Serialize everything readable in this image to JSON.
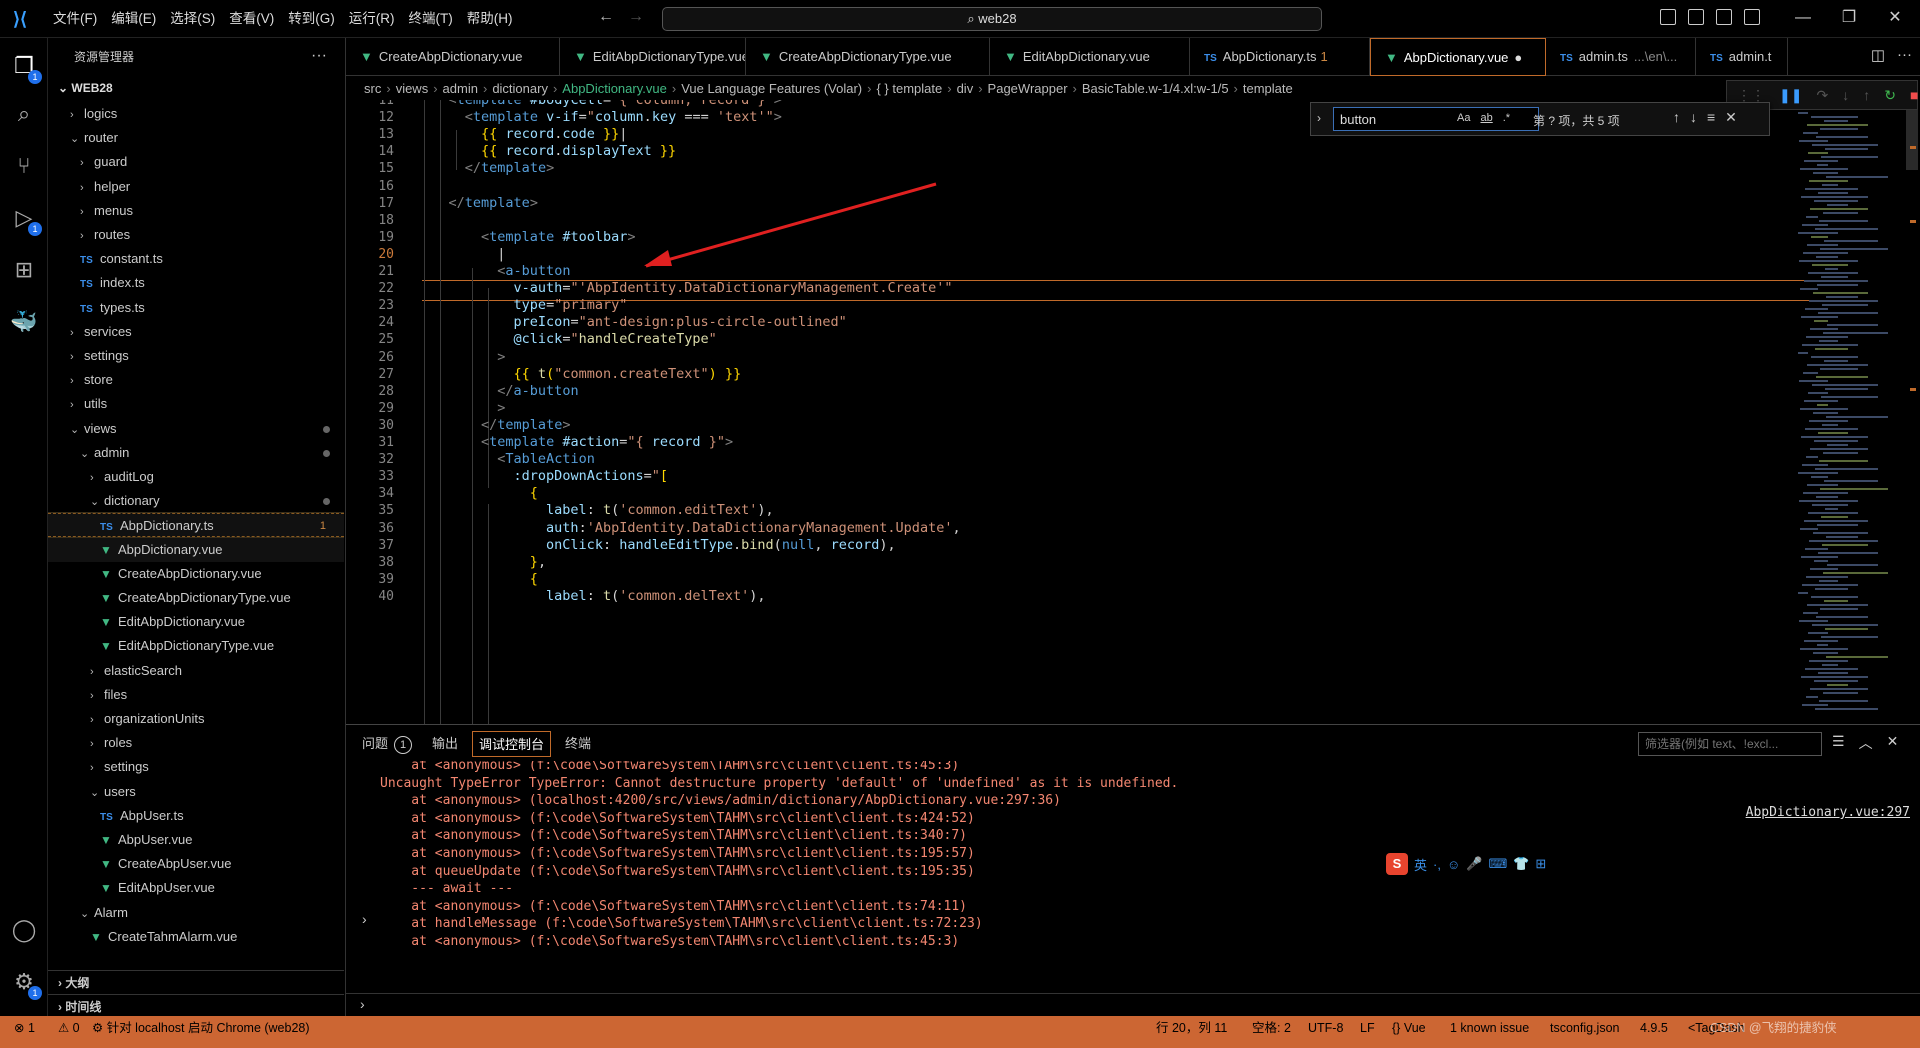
{
  "menubar": [
    "文件(F)",
    "编辑(E)",
    "选择(S)",
    "查看(V)",
    "转到(G)",
    "运行(R)",
    "终端(T)",
    "帮助(H)"
  ],
  "command_center": "web28",
  "sidebar": {
    "title": "资源管理器",
    "more": "···",
    "workspace": "WEB28",
    "tree": [
      {
        "label": "logics",
        "kind": "folder",
        "open": false,
        "depth": 1
      },
      {
        "label": "router",
        "kind": "folder",
        "open": true,
        "depth": 1
      },
      {
        "label": "guard",
        "kind": "folder",
        "open": false,
        "depth": 2
      },
      {
        "label": "helper",
        "kind": "folder",
        "open": false,
        "depth": 2
      },
      {
        "label": "menus",
        "kind": "folder",
        "open": false,
        "depth": 2
      },
      {
        "label": "routes",
        "kind": "folder",
        "open": false,
        "depth": 2
      },
      {
        "label": "constant.ts",
        "kind": "ts",
        "depth": 2
      },
      {
        "label": "index.ts",
        "kind": "ts",
        "depth": 2
      },
      {
        "label": "types.ts",
        "kind": "ts",
        "depth": 2
      },
      {
        "label": "services",
        "kind": "folder",
        "open": false,
        "depth": 1
      },
      {
        "label": "settings",
        "kind": "folder",
        "open": false,
        "depth": 1
      },
      {
        "label": "store",
        "kind": "folder",
        "open": false,
        "depth": 1
      },
      {
        "label": "utils",
        "kind": "folder",
        "open": false,
        "depth": 1
      },
      {
        "label": "views",
        "kind": "folder",
        "open": true,
        "depth": 1,
        "dot": true
      },
      {
        "label": "admin",
        "kind": "folder",
        "open": true,
        "depth": 2,
        "dot": true
      },
      {
        "label": "auditLog",
        "kind": "folder",
        "open": false,
        "depth": 3
      },
      {
        "label": "dictionary",
        "kind": "folder",
        "open": true,
        "depth": 3,
        "dot": true
      },
      {
        "label": "AbpDictionary.ts",
        "kind": "ts",
        "depth": 4,
        "count": "1",
        "selected": true
      },
      {
        "label": "AbpDictionary.vue",
        "kind": "vue",
        "depth": 4,
        "current": true
      },
      {
        "label": "CreateAbpDictionary.vue",
        "kind": "vue",
        "depth": 4
      },
      {
        "label": "CreateAbpDictionaryType.vue",
        "kind": "vue",
        "depth": 4
      },
      {
        "label": "EditAbpDictionary.vue",
        "kind": "vue",
        "depth": 4
      },
      {
        "label": "EditAbpDictionaryType.vue",
        "kind": "vue",
        "depth": 4
      },
      {
        "label": "elasticSearch",
        "kind": "folder",
        "open": false,
        "depth": 3
      },
      {
        "label": "files",
        "kind": "folder",
        "open": false,
        "depth": 3
      },
      {
        "label": "organizationUnits",
        "kind": "folder",
        "open": false,
        "depth": 3
      },
      {
        "label": "roles",
        "kind": "folder",
        "open": false,
        "depth": 3
      },
      {
        "label": "settings",
        "kind": "folder",
        "open": false,
        "depth": 3
      },
      {
        "label": "users",
        "kind": "folder",
        "open": true,
        "depth": 3
      },
      {
        "label": "AbpUser.ts",
        "kind": "ts",
        "depth": 4
      },
      {
        "label": "AbpUser.vue",
        "kind": "vue",
        "depth": 4
      },
      {
        "label": "CreateAbpUser.vue",
        "kind": "vue",
        "depth": 4
      },
      {
        "label": "EditAbpUser.vue",
        "kind": "vue",
        "depth": 4
      },
      {
        "label": "Alarm",
        "kind": "folder",
        "open": true,
        "depth": 2
      },
      {
        "label": "CreateTahmAlarm.vue",
        "kind": "vue",
        "depth": 3
      }
    ],
    "outline": "大纲",
    "timeline": "时间线"
  },
  "tabs": [
    {
      "label": "CreateAbpDictionary.vue",
      "kind": "vue"
    },
    {
      "label": "EditAbpDictionaryType.vue",
      "kind": "vue"
    },
    {
      "label": "CreateAbpDictionaryType.vue",
      "kind": "vue"
    },
    {
      "label": "EditAbpDictionary.vue",
      "kind": "vue"
    },
    {
      "label": "AbpDictionary.ts",
      "kind": "ts",
      "count": "1"
    },
    {
      "label": "AbpDictionary.vue",
      "kind": "vue",
      "active": true,
      "modified": "●"
    },
    {
      "label": "admin.ts",
      "kind": "ts",
      "path": "...\\en\\..."
    },
    {
      "label": "admin.t",
      "kind": "ts"
    }
  ],
  "breadcrumbs": [
    "src",
    "views",
    "admin",
    "dictionary",
    "AbpDictionary.vue",
    "Vue Language Features (Volar)",
    "{ } template",
    "div",
    "PageWrapper",
    "BasicTable.w-1/4.xl:w-1/5",
    "template"
  ],
  "find": {
    "value": "button",
    "opt_case": "Aa",
    "opt_word": "ab",
    "opt_regex": ".*",
    "count": "第 ? 项，共 5 项"
  },
  "editor": {
    "current_line": 20,
    "lines": [
      {
        "n": 11,
        "html": "    <span class='pun'>&lt;</span><span class='tag'>template</span> <span class='at'>#bodyCell</span><span class='txt'>=</span><span class='str'>\"{ column, record }\"</span><span class='pun'>&gt;</span>"
      },
      {
        "n": 12,
        "html": "      <span class='pun'>&lt;</span><span class='tag'>template</span> <span class='at'>v-if</span><span class='txt'>=</span><span class='str'>\"</span><span class='at'>column</span><span class='txt'>.</span><span class='at'>key</span> <span class='txt'>===</span> <span class='str'>'text'\"</span><span class='pun'>&gt;</span>"
      },
      {
        "n": 13,
        "html": "        <span class='br'>{{</span> <span class='at'>record</span><span class='txt'>.</span><span class='at'>code</span> <span class='br'>}}</span><span class='txt'>|</span>"
      },
      {
        "n": 14,
        "html": "        <span class='br'>{{</span> <span class='at'>record</span><span class='txt'>.</span><span class='at'>displayText</span> <span class='br'>}}</span>"
      },
      {
        "n": 15,
        "html": "      <span class='pun'>&lt;/</span><span class='tag'>template</span><span class='pun'>&gt;</span>"
      },
      {
        "n": 16,
        "html": ""
      },
      {
        "n": 17,
        "html": "    <span class='pun'>&lt;/</span><span class='tag'>template</span><span class='pun'>&gt;</span>"
      },
      {
        "n": 18,
        "html": ""
      },
      {
        "n": 19,
        "html": "        <span class='pun'>&lt;</span><span class='tag'>template</span> <span class='at'>#toolbar</span><span class='pun'>&gt;</span>"
      },
      {
        "n": 20,
        "html": "          <span class='txt'>|</span>"
      },
      {
        "n": 21,
        "html": "          <span class='pun'>&lt;</span><span class='tag'>a-button</span>"
      },
      {
        "n": 22,
        "html": "            <span class='at'>v-auth</span><span class='txt'>=</span><span class='str'>\"'AbpIdentity.DataDictionaryManagement.Create'\"</span>"
      },
      {
        "n": 23,
        "html": "            <span class='at'>type</span><span class='txt'>=</span><span class='str'>\"primary\"</span>"
      },
      {
        "n": 24,
        "html": "            <span class='at'>preIcon</span><span class='txt'>=</span><span class='str'>\"ant-design:plus-circle-outlined\"</span>"
      },
      {
        "n": 25,
        "html": "            <span class='at'>@click</span><span class='txt'>=</span><span class='str'>\"</span><span class='fn'>handleCreateType</span><span class='str'>\"</span>"
      },
      {
        "n": 26,
        "html": "          <span class='pun'>&gt;</span>"
      },
      {
        "n": 27,
        "html": "            <span class='br'>{{</span> <span class='fn'>t</span><span class='br'>(</span><span class='str'>\"common.createText\"</span><span class='br'>)</span> <span class='br'>}}</span>"
      },
      {
        "n": 28,
        "html": "          <span class='pun'>&lt;/</span><span class='tag'>a-button</span>"
      },
      {
        "n": 29,
        "html": "          <span class='pun'>&gt;</span>"
      },
      {
        "n": 30,
        "html": "        <span class='pun'>&lt;/</span><span class='tag'>template</span><span class='pun'>&gt;</span>"
      },
      {
        "n": 31,
        "html": "        <span class='pun'>&lt;</span><span class='tag'>template</span> <span class='at'>#action</span><span class='txt'>=</span><span class='str'>\"{ </span><span class='at'>record</span><span class='str'> }\"</span><span class='pun'>&gt;</span>"
      },
      {
        "n": 32,
        "html": "          <span class='pun'>&lt;</span><span class='tag'>TableAction</span>"
      },
      {
        "n": 33,
        "html": "            <span class='at'>:dropDownActions</span><span class='txt'>=</span><span class='str'>\"</span><span class='br'>[</span>"
      },
      {
        "n": 34,
        "html": "              <span class='br'>{</span>"
      },
      {
        "n": 35,
        "html": "                <span class='at'>label</span><span class='txt'>: </span><span class='fn'>t</span><span class='txt'>(</span><span class='str'>'common.editText'</span><span class='txt'>),</span>"
      },
      {
        "n": 36,
        "html": "                <span class='at'>auth</span><span class='txt'>:</span><span class='str'>'AbpIdentity.DataDictionaryManagement.Update'</span><span class='txt'>,</span>"
      },
      {
        "n": 37,
        "html": "                <span class='at'>onClick</span><span class='txt'>: </span><span class='at'>handleEditType</span><span class='txt'>.</span><span class='fn'>bind</span><span class='txt'>(</span><span class='t'>null</span><span class='txt'>, </span><span class='at'>record</span><span class='txt'>),</span>"
      },
      {
        "n": 38,
        "html": "              <span class='br'>}</span><span class='txt'>,</span>"
      },
      {
        "n": 39,
        "html": "              <span class='br'>{</span>"
      },
      {
        "n": 40,
        "html": "                <span class='at'>label</span><span class='txt'>: </span><span class='fn'>t</span><span class='txt'>(</span><span class='str'>'common.delText'</span><span class='txt'>),</span>"
      }
    ]
  },
  "panel": {
    "tabs": [
      {
        "label": "问题",
        "badge": "1"
      },
      {
        "label": "输出"
      },
      {
        "label": "调试控制台",
        "active": true
      },
      {
        "label": "终端"
      }
    ],
    "filter_placeholder": "筛选器(例如 text、!excl...",
    "source_link": "AbpDictionary.vue:297",
    "lines": [
      {
        "text": "    at <anonymous> (f:\\code\\SoftwareSystem\\TAHM\\src\\client\\client.ts:45:3)",
        "cls": "ind"
      },
      {
        "text": "Uncaught TypeError TypeError: Cannot destructure property 'default' of 'undefined' as it is undefined.",
        "cls": "err"
      },
      {
        "text": "    at <anonymous> (localhost:4200/src/views/admin/dictionary/AbpDictionary.vue:297:36)",
        "cls": "ind"
      },
      {
        "text": "    at <anonymous> (f:\\code\\SoftwareSystem\\TAHM\\src\\client\\client.ts:424:52)",
        "cls": "ind"
      },
      {
        "text": "    at <anonymous> (f:\\code\\SoftwareSystem\\TAHM\\src\\client\\client.ts:340:7)",
        "cls": "ind"
      },
      {
        "text": "    at <anonymous> (f:\\code\\SoftwareSystem\\TAHM\\src\\client\\client.ts:195:57)",
        "cls": "ind"
      },
      {
        "text": "    at queueUpdate (f:\\code\\SoftwareSystem\\TAHM\\src\\client\\client.ts:195:35)",
        "cls": "ind"
      },
      {
        "text": "    --- await ---",
        "cls": "ind"
      },
      {
        "text": "    at <anonymous> (f:\\code\\SoftwareSystem\\TAHM\\src\\client\\client.ts:74:11)",
        "cls": "ind"
      },
      {
        "text": "    at handleMessage (f:\\code\\SoftwareSystem\\TAHM\\src\\client\\client.ts:72:23)",
        "cls": "ind"
      },
      {
        "text": "    at <anonymous> (f:\\code\\SoftwareSystem\\TAHM\\src\\client\\client.ts:45:3)",
        "cls": "ind"
      }
    ],
    "ime": "英"
  },
  "statusbar": {
    "errors": "⊗ 1",
    "warnings": "⚠ 0",
    "debug": "针对 localhost 启动 Chrome (web28)",
    "position": "行 20，列 11",
    "spaces": "空格: 2",
    "encoding": "UTF-8",
    "eol": "LF",
    "language": "Vue",
    "issues": "1 known issue",
    "tsconfig": "tsconfig.json",
    "version": "4.9.5",
    "tag": "<TagDash",
    "watermark": "CSDN @飞翔的捷豹侠"
  }
}
